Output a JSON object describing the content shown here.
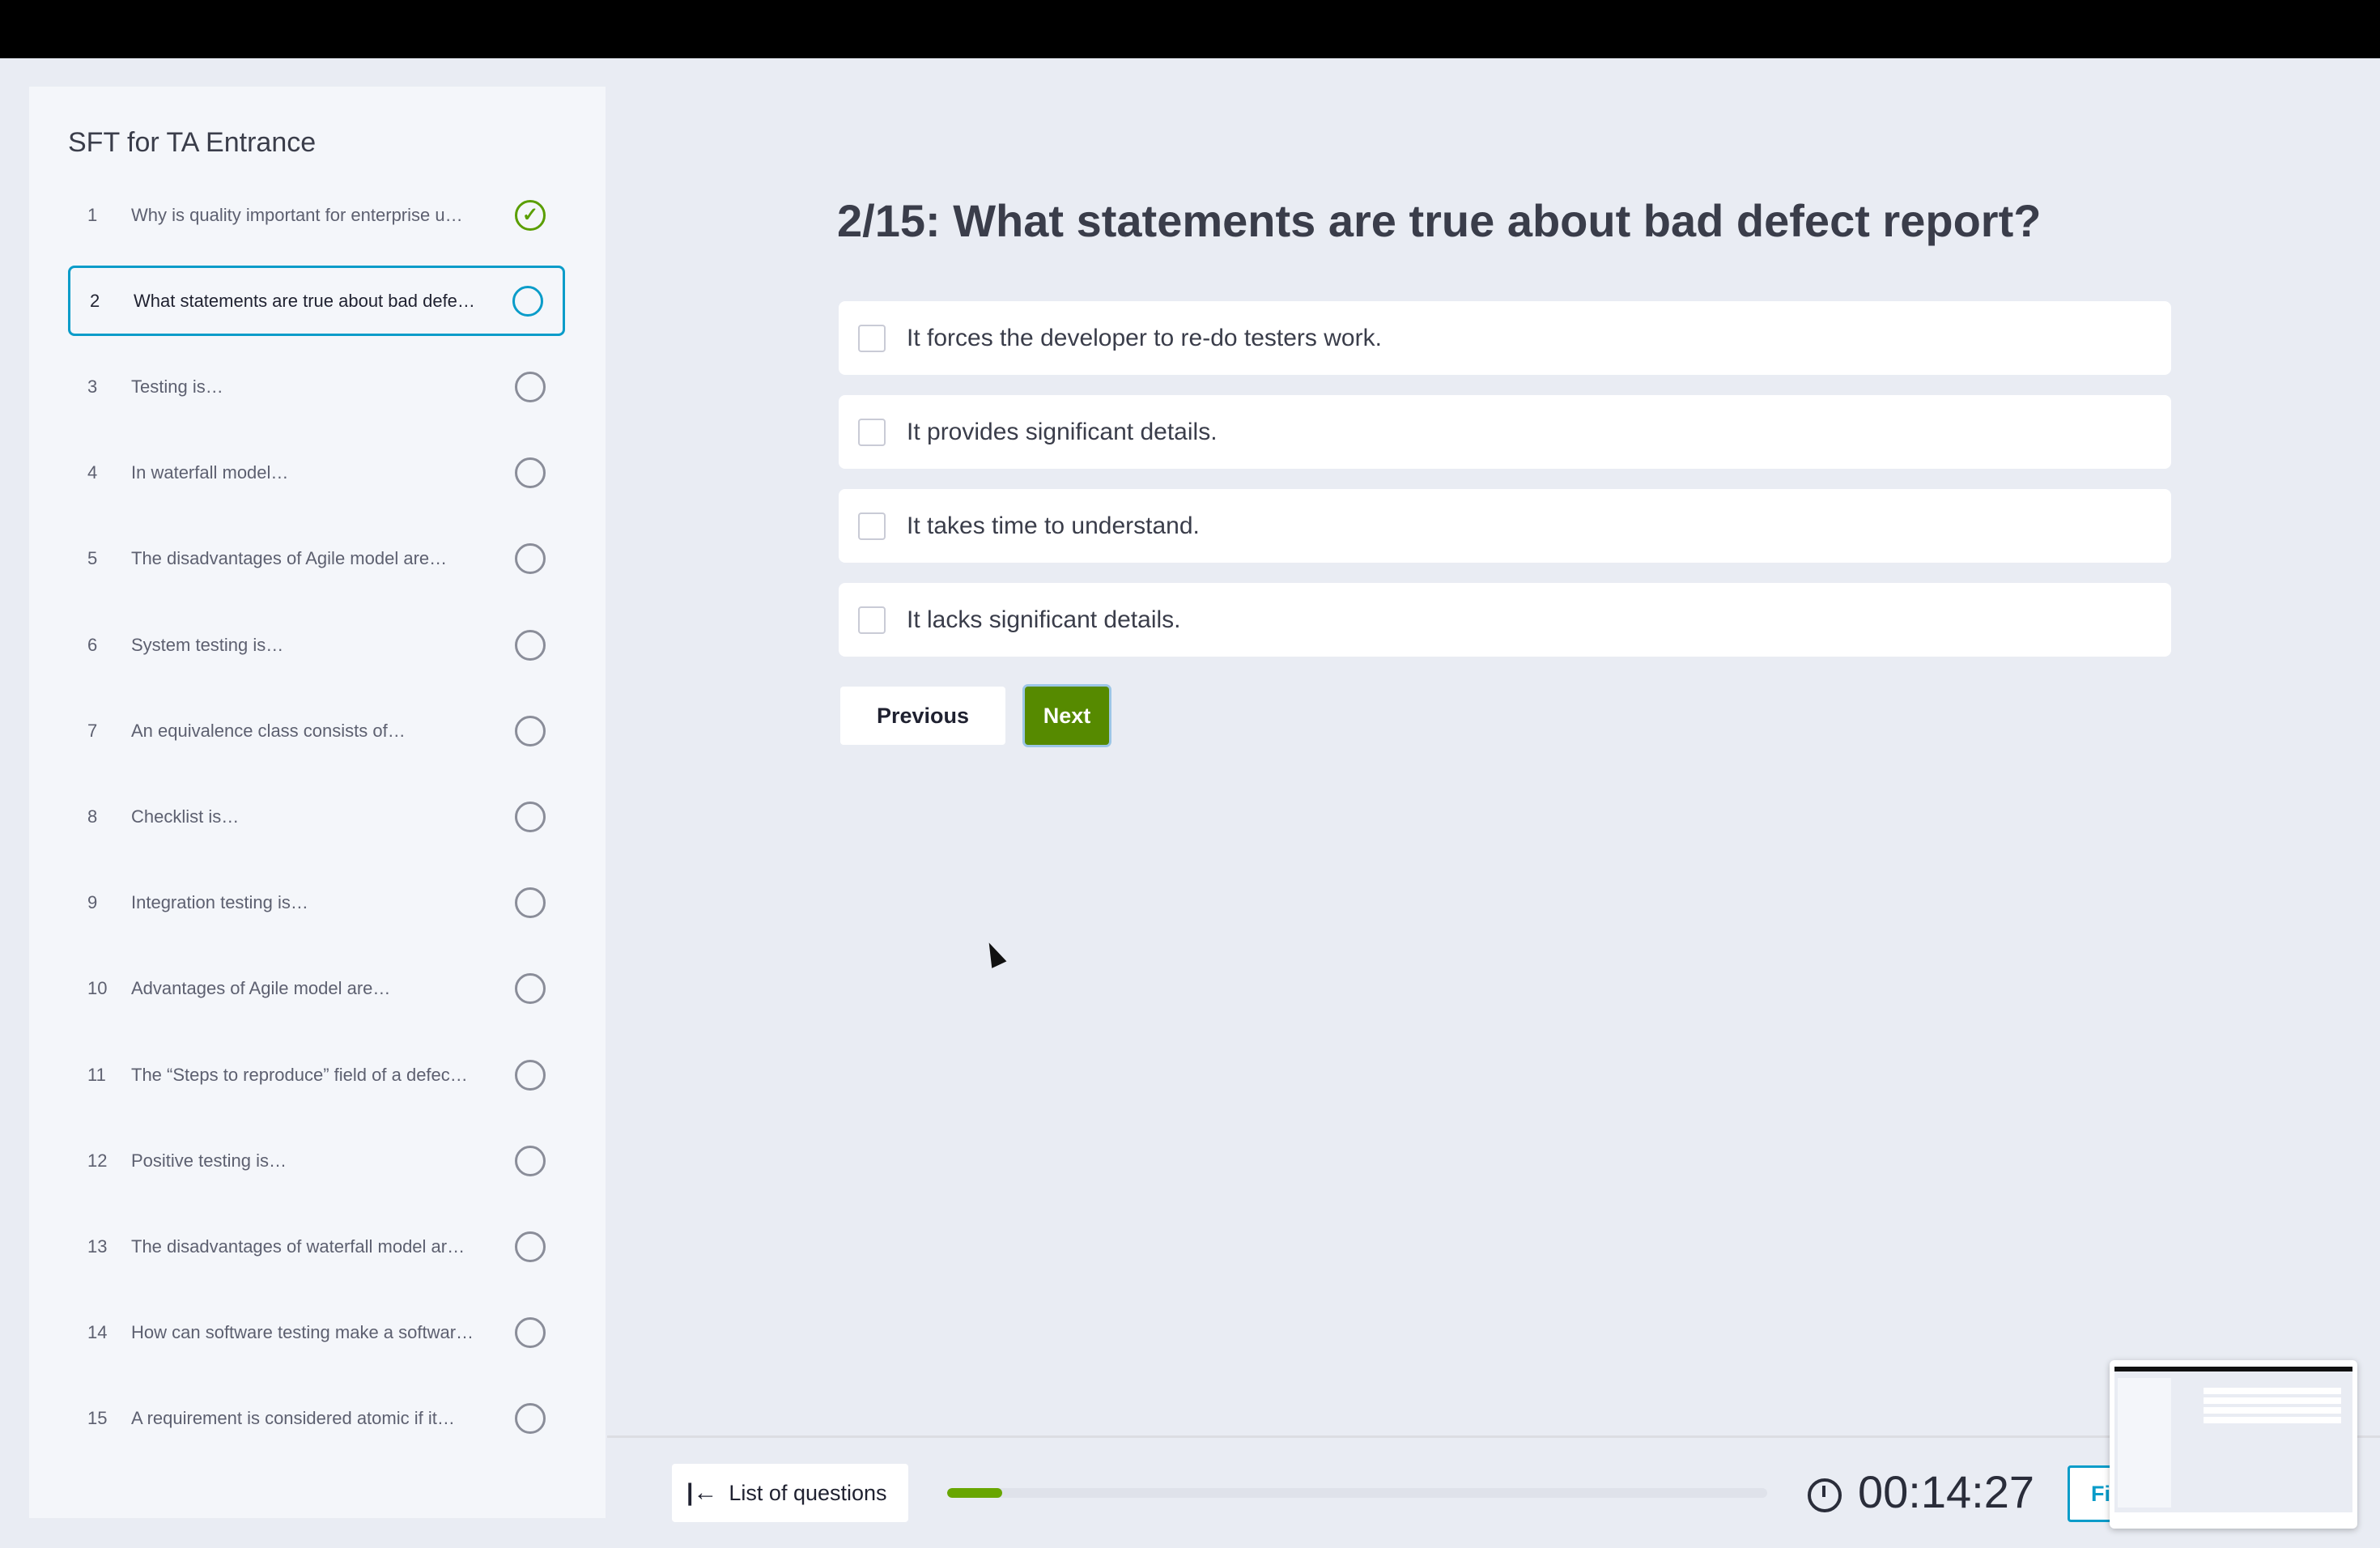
{
  "quiz_title": "SFT for TA Entrance",
  "questions": [
    {
      "num": "1",
      "text": "Why is quality important for enterprise u…",
      "status": "answered"
    },
    {
      "num": "2",
      "text": "What statements are true about bad defe…",
      "status": "current"
    },
    {
      "num": "3",
      "text": "Testing is…",
      "status": "unanswered"
    },
    {
      "num": "4",
      "text": "In waterfall model…",
      "status": "unanswered"
    },
    {
      "num": "5",
      "text": "The disadvantages of Agile model are…",
      "status": "unanswered"
    },
    {
      "num": "6",
      "text": "System testing is…",
      "status": "unanswered"
    },
    {
      "num": "7",
      "text": "An equivalence class consists of…",
      "status": "unanswered"
    },
    {
      "num": "8",
      "text": "Checklist is…",
      "status": "unanswered"
    },
    {
      "num": "9",
      "text": "Integration testing is…",
      "status": "unanswered"
    },
    {
      "num": "10",
      "text": "Advantages of Agile model are…",
      "status": "unanswered"
    },
    {
      "num": "11",
      "text": "The “Steps to reproduce” field of a defec…",
      "status": "unanswered"
    },
    {
      "num": "12",
      "text": "Positive testing is…",
      "status": "unanswered"
    },
    {
      "num": "13",
      "text": "The disadvantages of waterfall model ar…",
      "status": "unanswered"
    },
    {
      "num": "14",
      "text": "How can software testing make a softwar…",
      "status": "unanswered"
    },
    {
      "num": "15",
      "text": "A requirement is considered atomic if it…",
      "status": "unanswered"
    }
  ],
  "main": {
    "question_title": "2/15: What statements are true about bad defect report?",
    "options": [
      "It forces the developer to re-do testers work.",
      "It provides significant details.",
      "It takes time to understand.",
      "It lacks significant details."
    ],
    "previous_label": "Previous",
    "next_label": "Next"
  },
  "footer": {
    "list_label": "List of questions",
    "list_icon": "arrow-left-to-bar-icon",
    "progress_percent": 6.7,
    "timer": "00:14:27",
    "finish_label": "Fi"
  },
  "colors": {
    "accent": "#0a9cc9",
    "success": "#5a9e00",
    "next_button": "#568a00",
    "progress": "#68a600"
  }
}
